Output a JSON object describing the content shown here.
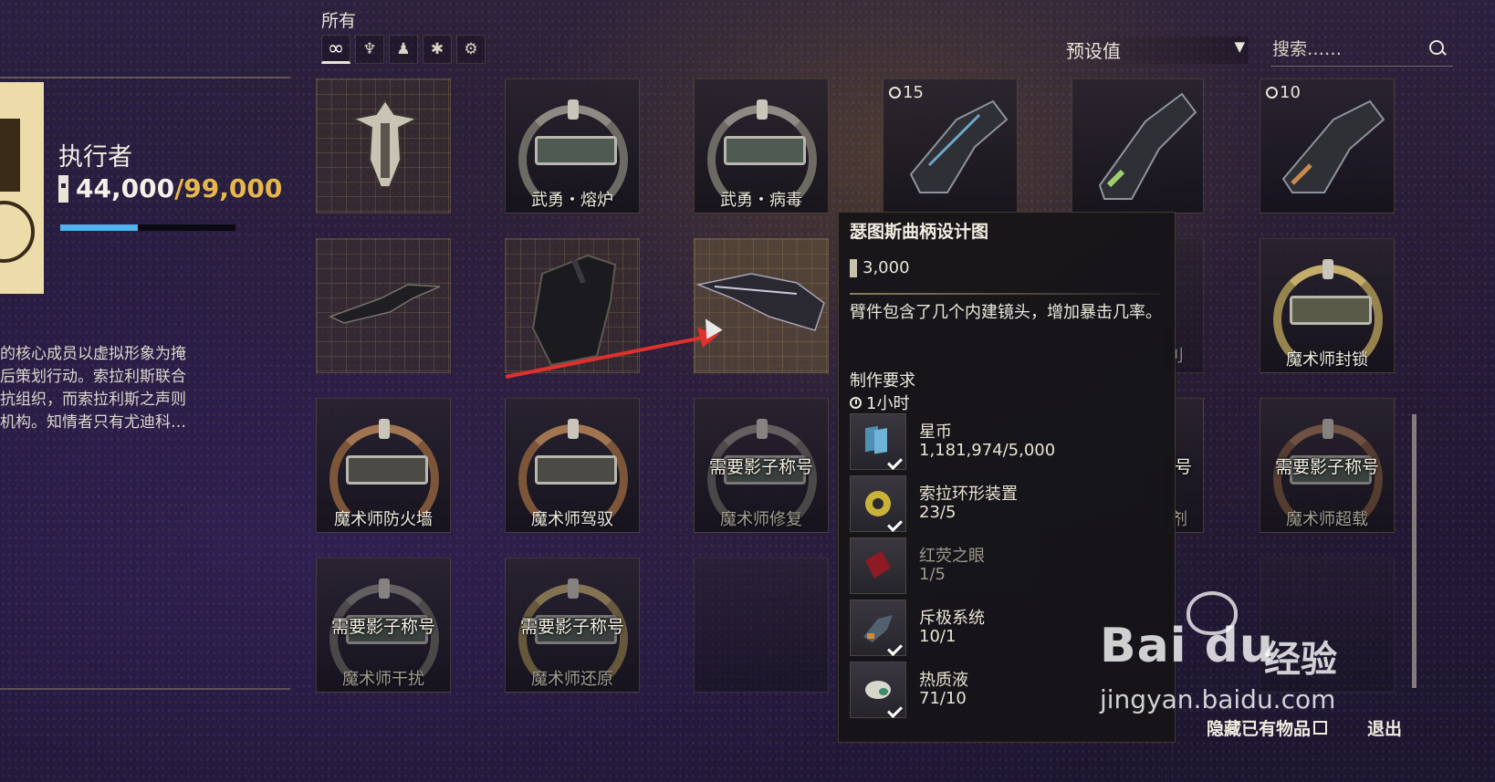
{
  "header": {
    "all_label": "所有",
    "filters": [
      {
        "name": "infinity-icon",
        "glyph": "∞",
        "active": true
      },
      {
        "name": "helmet-icon",
        "glyph": "♆",
        "active": false
      },
      {
        "name": "figure-icon",
        "glyph": "♟",
        "active": false
      },
      {
        "name": "gear-cluster-icon",
        "glyph": "✱",
        "active": false
      },
      {
        "name": "module-icon",
        "glyph": "⚙",
        "active": false
      }
    ],
    "preset": {
      "label": "预设值",
      "arrow": "▼"
    },
    "search": {
      "placeholder": "搜索……"
    }
  },
  "profile": {
    "rank_title": "执行者",
    "standing_current": "44,000",
    "standing_max": "/99,000",
    "progress_fraction": 0.444,
    "lore_lines": [
      "的核心成员以虚拟形象为掩",
      "后策划行动。索拉利斯联合",
      "抗组织，而索拉利斯之声则",
      "机构。知情者只有尤迪科…"
    ]
  },
  "grid": {
    "cards": [
      {
        "id": "c1",
        "name": "",
        "owned": ""
      },
      {
        "id": "c2",
        "name": "武勇・熔炉",
        "owned": ""
      },
      {
        "id": "c3",
        "name": "武勇・病毒",
        "owned": ""
      },
      {
        "id": "c4",
        "name": "",
        "owned": "15"
      },
      {
        "id": "c5",
        "name": "",
        "owned": ""
      },
      {
        "id": "c6",
        "name": "",
        "owned": "10"
      },
      {
        "id": "c7",
        "name": "",
        "owned": ""
      },
      {
        "id": "c8",
        "name": "",
        "owned": ""
      },
      {
        "id": "c9",
        "name": "",
        "owned": ""
      },
      {
        "id": "c10",
        "name": "剂",
        "owned": ""
      },
      {
        "id": "c11",
        "name": "魔术师封锁",
        "owned": ""
      },
      {
        "id": "c12",
        "name": "魔术师防火墙",
        "owned": ""
      },
      {
        "id": "c13",
        "name": "魔术师驾驭",
        "owned": ""
      },
      {
        "id": "c14",
        "name": "魔术师修复",
        "lock": "需要影子称号"
      },
      {
        "id": "c15",
        "name": "剂",
        "lock": "号"
      },
      {
        "id": "c16",
        "name": "魔术师超载",
        "lock": "需要影子称号"
      },
      {
        "id": "c17",
        "name": "魔术师干扰",
        "lock": "需要影子称号"
      },
      {
        "id": "c18",
        "name": "魔术师还原",
        "lock": "需要影子称号"
      }
    ]
  },
  "tooltip": {
    "title": "瑟图斯曲柄设计图",
    "price": "3,000",
    "description": "臂件包含了几个内建镜头，增加暴击几率。",
    "requirements_label": "制作要求",
    "time": "1小时",
    "requirements": [
      {
        "name": "星币",
        "count": "1,181,974/5,000",
        "met": true,
        "icon": "credits-icon"
      },
      {
        "name": "索拉环形装置",
        "count": "23/5",
        "met": true,
        "icon": "toroid-icon"
      },
      {
        "name": "红荧之眼",
        "count": "1/5",
        "met": false,
        "icon": "red-gem-icon"
      },
      {
        "name": "斥极系统",
        "count": "10/1",
        "met": true,
        "icon": "repeller-system-icon"
      },
      {
        "name": "热质液",
        "count": "71/10",
        "met": true,
        "icon": "thermal-sludge-icon"
      }
    ]
  },
  "footer": {
    "hide_owned": "隐藏已有物品",
    "exit": "退出"
  },
  "watermark": {
    "brand": "Bai du",
    "cn": "经验",
    "url": "jingyan.baidu.com"
  },
  "colors": {
    "accent_gold": "#e6b84c",
    "progress_blue": "#4fb4ee"
  }
}
